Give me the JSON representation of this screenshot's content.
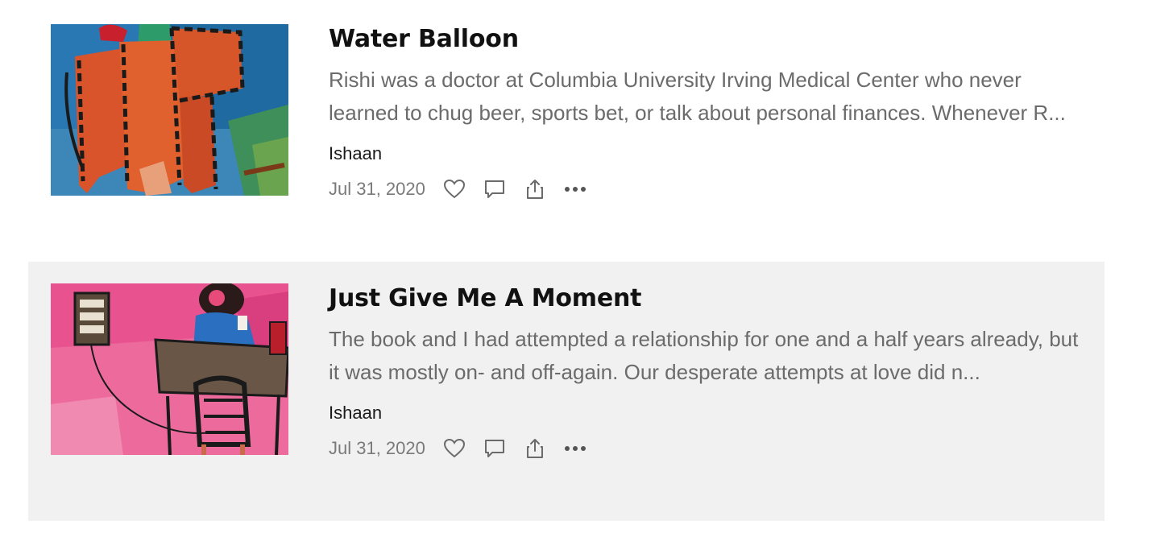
{
  "posts": [
    {
      "title": "Water Balloon",
      "excerpt": "Rishi was a doctor at Columbia University Irving Medical Center who never learned to chug beer, sports bet, or talk about personal finances. Whenever R...",
      "author": "Ishaan",
      "date": "Jul 31, 2020",
      "thumbnail": "painting-orange-chair-blue-background"
    },
    {
      "title": "Just Give Me A Moment",
      "excerpt": "The book and I had attempted a relationship for one and a half years already, but it was mostly on- and off-again. Our desperate attempts at love did n...",
      "author": "Ishaan",
      "date": "Jul 31, 2020",
      "thumbnail": "painting-person-at-desk-pink-background"
    }
  ],
  "icons": {
    "like": "heart-icon",
    "comment": "comment-icon",
    "share": "share-icon",
    "more": "more-icon"
  },
  "colors": {
    "title": "#111111",
    "excerpt": "#6b6b6b",
    "date": "#7a7a7a",
    "highlight_row": "#f1f1f1"
  }
}
